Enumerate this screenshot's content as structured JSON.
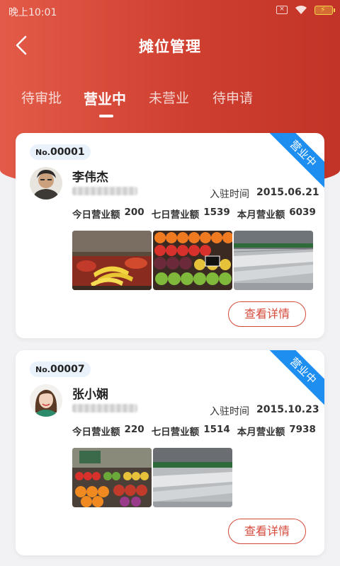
{
  "status_bar": {
    "time": "晚上10:01"
  },
  "header": {
    "title": "摊位管理"
  },
  "tabs": [
    {
      "label": "待审批"
    },
    {
      "label": "营业中"
    },
    {
      "label": "未营业"
    },
    {
      "label": "待申请"
    }
  ],
  "active_tab": 1,
  "stalls": [
    {
      "number_prefix": "No.",
      "number": "00001",
      "status": "营业中",
      "owner": "李伟杰",
      "join_label": "入驻时间",
      "join_date": "2015.06.21",
      "today_label": "今日营业额",
      "today_value": "200",
      "seven_label": "七日营业额",
      "seven_value": "1539",
      "month_label": "本月营业额",
      "month_value": "6039",
      "detail_label": "查看详情"
    },
    {
      "number_prefix": "No.",
      "number": "00007",
      "status": "营业中",
      "owner": "张小娴",
      "join_label": "入驻时间",
      "join_date": "2015.10.23",
      "today_label": "今日营业额",
      "today_value": "220",
      "seven_label": "七日营业额",
      "seven_value": "1514",
      "month_label": "本月营业额",
      "month_value": "7938",
      "detail_label": "查看详情"
    }
  ],
  "colors": {
    "primary": "#cf3f30",
    "ribbon": "#1e8ff0",
    "button_border": "#d5493a"
  }
}
